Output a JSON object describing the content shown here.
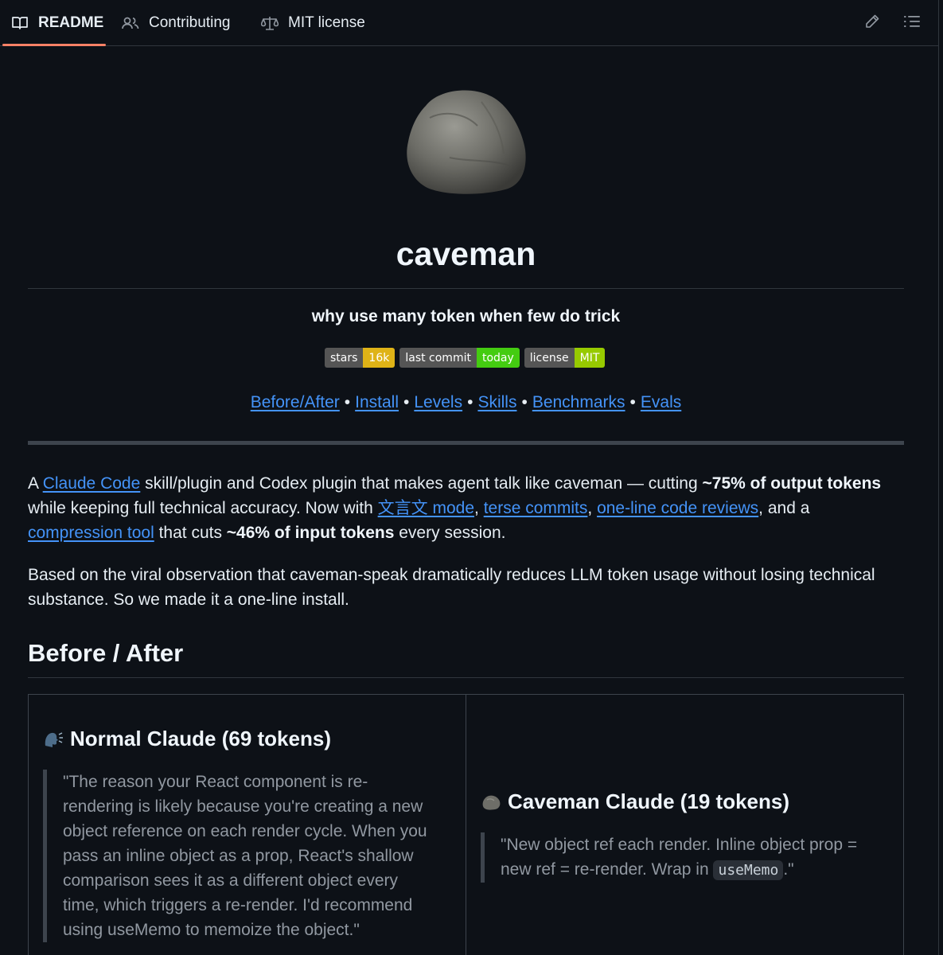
{
  "tabs": [
    {
      "label": "README",
      "icon": "book-icon",
      "active": true
    },
    {
      "label": "Contributing",
      "icon": "people-icon"
    },
    {
      "label": "MIT license",
      "icon": "law-icon"
    }
  ],
  "toolbar": {
    "edit_icon": "pencil-icon",
    "outline_icon": "list-icon"
  },
  "header": {
    "title": "caveman",
    "tagline": "why use many token when few do trick"
  },
  "badges": [
    {
      "label": "stars",
      "value": "16k",
      "color": "#dfb317"
    },
    {
      "label": "last commit",
      "value": "today",
      "color": "#4c1"
    },
    {
      "label": "license",
      "value": "MIT",
      "color": "#97ca00"
    }
  ],
  "nav": {
    "links": [
      "Before/After",
      "Install",
      "Levels",
      "Skills",
      "Benchmarks",
      "Evals"
    ],
    "separator": "•"
  },
  "intro": {
    "p1_a": "A ",
    "p1_link1": "Claude Code",
    "p1_b": " skill/plugin and Codex plugin that makes agent talk like caveman — cutting ",
    "p1_bold1": "~75% of output tokens",
    "p1_c": "while keeping full technical accuracy. Now with ",
    "p1_link2": "文言文 mode",
    "p1_comma1": ", ",
    "p1_link3": "terse commits",
    "p1_comma2": ", ",
    "p1_link4": "one-line code reviews",
    "p1_d": ", and a",
    "p1_link5": "compression tool",
    "p1_e": " that cuts ",
    "p1_bold2": "~46% of input tokens",
    "p1_f": " every session.",
    "p2_line1": "Based on the viral observation that caveman-speak dramatically reduces LLM token usage without losing technical",
    "p2_line2": "substance. So we made it a one-line install."
  },
  "section": {
    "heading": "Before / After"
  },
  "comparison": {
    "normal": {
      "heading": "Normal Claude (69 tokens)",
      "icon": "speaking-head-icon",
      "quote_lines": [
        "\"The reason your React component is re-",
        "rendering is likely because you're creating a new",
        "object reference on each render cycle. When you",
        "pass an inline object as a prop, React's shallow",
        "comparison sees it as a different object every",
        "time, which triggers a re-render. I'd recommend",
        "using useMemo to memoize the object.\""
      ]
    },
    "caveman": {
      "heading": "Caveman Claude (19 tokens)",
      "icon": "rock-icon",
      "quote_line1": "\"New object ref each render. Inline object prop =",
      "quote_line2_a": "new ref = re-render. Wrap in ",
      "quote_code": "useMemo",
      "quote_line2_b": ".\""
    }
  }
}
